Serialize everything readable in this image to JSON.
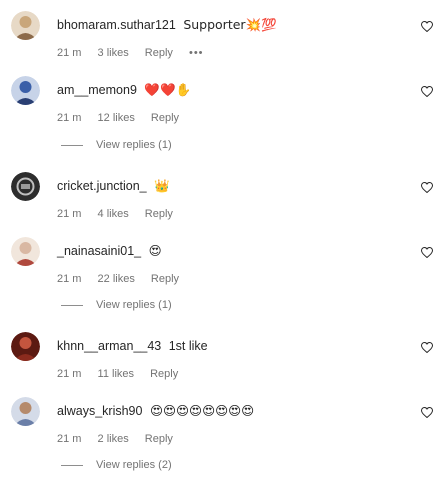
{
  "comments": [
    {
      "username": "bhomaram.suthar121",
      "text": "Supporter💥💯",
      "time": "21 m",
      "likes": "3 likes",
      "reply_label": "Reply",
      "more_label": "•••",
      "avatar_color": "#c9a67a"
    },
    {
      "username": "am__memon9",
      "text": "❤️❤️✋",
      "time": "21 m",
      "likes": "12 likes",
      "reply_label": "Reply",
      "view_replies": "View replies (1)",
      "avatar_color": "#3a5fa8"
    },
    {
      "username": "cricket.junction_",
      "text": "👑",
      "time": "21 m",
      "likes": "4 likes",
      "reply_label": "Reply",
      "avatar_color": "#2d2d2d"
    },
    {
      "username": "_nainasaini01_",
      "text": "😍",
      "time": "21 m",
      "likes": "22 likes",
      "reply_label": "Reply",
      "view_replies": "View replies (1)",
      "avatar_color": "#d9b8a3"
    },
    {
      "username": "khnn__arman__43",
      "text": "1st like",
      "time": "21 m",
      "likes": "11 likes",
      "reply_label": "Reply",
      "avatar_color": "#8b2b1e"
    },
    {
      "username": "always_krish90",
      "text": "😍😍😍😍😍😍😍😍",
      "time": "21 m",
      "likes": "2 likes",
      "reply_label": "Reply",
      "view_replies": "View replies (2)",
      "avatar_color": "#6b7fa8"
    }
  ],
  "colors": {
    "text": "#262626",
    "secondary": "#737373"
  }
}
